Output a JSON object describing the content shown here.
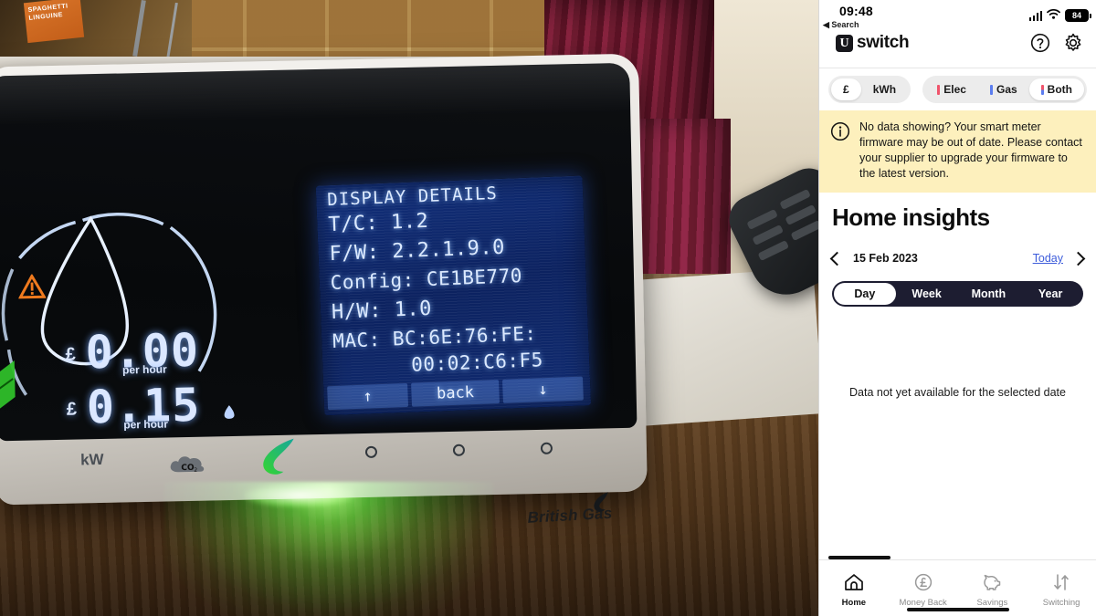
{
  "photo": {
    "device_brand": "British Gas",
    "meter_display": {
      "title": "DISPLAY DETAILS",
      "lines": [
        "T/C: 1.2",
        "F/W: 2.2.1.9.0",
        "Config: CE1BE770",
        "H/W: 1.0",
        "MAC: BC:6E:76:FE:",
        "00:02:C6:F5"
      ],
      "buttons": {
        "up": "↑",
        "back": "back",
        "down": "↓"
      }
    },
    "gauge": {
      "elec_currency": "£",
      "elec_value": "0.00",
      "elec_unit": "per hour",
      "gas_currency": "£",
      "gas_value": "0.15",
      "gas_unit": "per hour",
      "warning_icon": "warning-triangle-icon",
      "flame_icon": "flame-icon"
    },
    "under_icons": {
      "pound": "£",
      "kw": "kW",
      "co2": "CO",
      "co2_sub": "2"
    },
    "colors": {
      "lcd_blue": "#12307c",
      "lcd_text": "#dbe9ff",
      "led_green": "#3cdc32",
      "warning_orange": "#e8751a",
      "brand_teal": "#0f8a8a"
    }
  },
  "app": {
    "statusbar": {
      "time": "09:48",
      "back_label": "◀ Search",
      "battery": "84",
      "signal_icon": "cellular-signal-icon",
      "wifi_icon": "wifi-icon",
      "battery_icon": "battery-icon"
    },
    "header": {
      "logo_mark": "U",
      "logo_text": "switch",
      "help_icon": "help-circle-icon",
      "settings_icon": "gear-icon"
    },
    "unit_toggle": {
      "options": [
        "£",
        "kWh"
      ],
      "selected": "£"
    },
    "fuel_toggle": {
      "options": [
        "Elec",
        "Gas",
        "Both"
      ],
      "selected": "Both",
      "elec_color": "#f0546b",
      "gas_color": "#5b7df0"
    },
    "banner": {
      "icon": "info-circle-icon",
      "text": "No data showing? Your smart meter firmware may be out of date. Please contact your supplier to upgrade your firmware to the latest version.",
      "bg_color": "#fdf0bd"
    },
    "page_title": "Home insights",
    "date_nav": {
      "prev_icon": "chevron-left-icon",
      "date": "15 Feb 2023",
      "today_label": "Today",
      "next_icon": "chevron-right-icon",
      "link_color": "#3d5cdb"
    },
    "period_selector": {
      "options": [
        "Day",
        "Week",
        "Month",
        "Year"
      ],
      "selected": "Day"
    },
    "empty_state": "Data not yet available for the selected date",
    "tabbar": {
      "items": [
        {
          "label": "Home",
          "icon": "home-icon",
          "active": true
        },
        {
          "label": "Money Back",
          "icon": "pound-circle-icon",
          "active": false
        },
        {
          "label": "Savings",
          "icon": "piggy-bank-icon",
          "active": false
        },
        {
          "label": "Switching",
          "icon": "switch-arrows-icon",
          "active": false
        }
      ]
    }
  }
}
